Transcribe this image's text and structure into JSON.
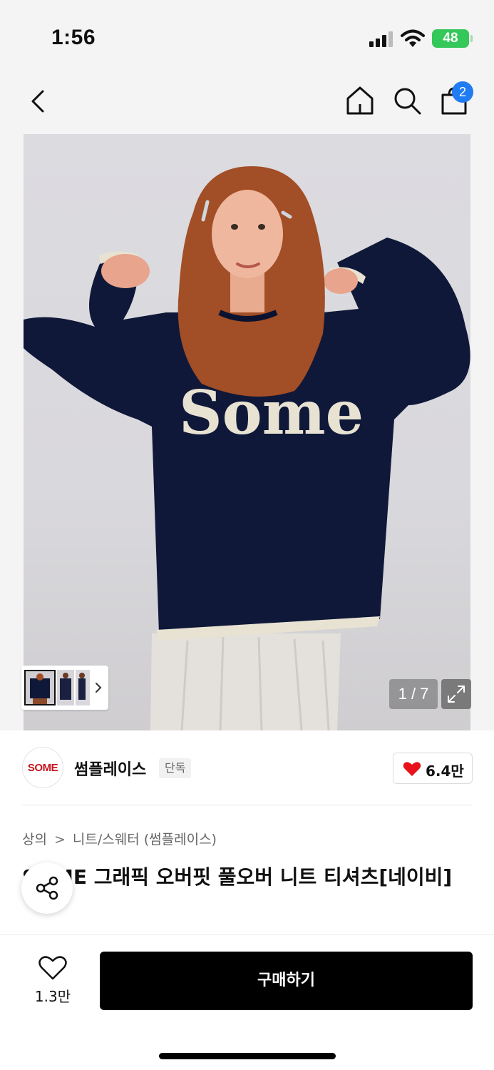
{
  "status_bar": {
    "time": "1:56",
    "battery": "48"
  },
  "nav": {
    "cart_count": "2"
  },
  "gallery": {
    "counter": "1 / 7",
    "photo_text": "Some",
    "thumbnails": [
      "thumbnail-1",
      "thumbnail-2",
      "thumbnail-3"
    ]
  },
  "brand": {
    "logo_text": "SOME",
    "name": "썸플레이스",
    "tag": "단독",
    "likes": "6.4만",
    "heart_color": "#e8121b"
  },
  "breadcrumb": {
    "level1": "상의",
    "separator": ">",
    "level2": "니트/스웨터 (썸플레이스)"
  },
  "product": {
    "title": "SOME 그래픽 오버핏 풀오버 니트 티셔츠[네이비]"
  },
  "bottom_bar": {
    "wish_count": "1.3만",
    "buy_label": "구매하기"
  },
  "colors": {
    "accent": "#1f7cf2",
    "battery": "#34c759",
    "brand_red": "#c6131b",
    "sweater": "#0f1838"
  }
}
